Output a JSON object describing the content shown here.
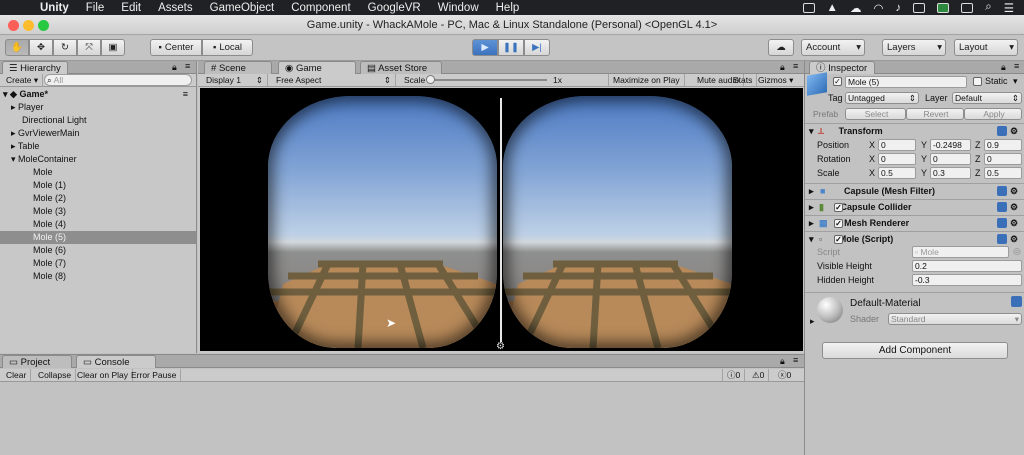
{
  "menubar": {
    "app": "Unity",
    "items": [
      "File",
      "Edit",
      "Assets",
      "GameObject",
      "Component",
      "GoogleVR",
      "Window",
      "Help"
    ]
  },
  "window": {
    "title": "Game.unity - WhackAMole - PC, Mac & Linux Standalone (Personal) <OpenGL 4.1>"
  },
  "toolbar": {
    "pivot_center": "Center",
    "pivot_local": "Local",
    "account": "Account",
    "layers": "Layers",
    "layout": "Layout"
  },
  "hierarchy": {
    "tab": "Hierarchy",
    "create": "Create",
    "search_placeholder": "All",
    "scene": "Game*",
    "items": [
      "Player",
      "Directional Light",
      "GvrViewerMain",
      "Table",
      "MoleContainer",
      "Mole",
      "Mole (1)",
      "Mole (2)",
      "Mole (3)",
      "Mole (4)",
      "Mole (5)",
      "Mole (6)",
      "Mole (7)",
      "Mole (8)"
    ]
  },
  "viewtabs": {
    "scene": "Scene",
    "game": "Game",
    "asset_store": "Asset Store"
  },
  "gamebar": {
    "display": "Display 1",
    "aspect": "Free Aspect",
    "scale_label": "Scale",
    "scale_value": "1x",
    "maximize": "Maximize on Play",
    "mute": "Mute audio",
    "stats": "Stats",
    "gizmos": "Gizmos"
  },
  "bottom": {
    "project_tab": "Project",
    "console_tab": "Console",
    "clear": "Clear",
    "collapse": "Collapse",
    "clear_on_play": "Clear on Play",
    "error_pause": "Error Pause",
    "info_count": "0",
    "warn_count": "0",
    "error_count": "0"
  },
  "inspector": {
    "tab": "Inspector",
    "object_name": "Mole (5)",
    "static": "Static",
    "tag_label": "Tag",
    "tag_value": "Untagged",
    "layer_label": "Layer",
    "layer_value": "Default",
    "prefab_label": "Prefab",
    "select": "Select",
    "revert": "Revert",
    "apply": "Apply",
    "transform": {
      "title": "Transform",
      "position_label": "Position",
      "rotation_label": "Rotation",
      "scale_label": "Scale",
      "x": "X",
      "y": "Y",
      "z": "Z",
      "position": [
        "0",
        "-0.2498",
        "0.9"
      ],
      "rotation": [
        "0",
        "0",
        "0"
      ],
      "scale": [
        "0.5",
        "0.3",
        "0.5"
      ]
    },
    "components": [
      "Capsule (Mesh Filter)",
      "Capsule Collider",
      "Mesh Renderer",
      "Mole (Script)"
    ],
    "script": {
      "script_label": "Script",
      "script_value": "Mole",
      "visible_label": "Visible Height",
      "visible_value": "0.2",
      "hidden_label": "Hidden Height",
      "hidden_value": "-0.3"
    },
    "material": {
      "name": "Default-Material",
      "shader_label": "Shader",
      "shader_value": "Standard"
    },
    "add_component": "Add Component"
  },
  "colors": {
    "accent_blue": "#3c73bf",
    "selection": "#8e8e8e"
  }
}
